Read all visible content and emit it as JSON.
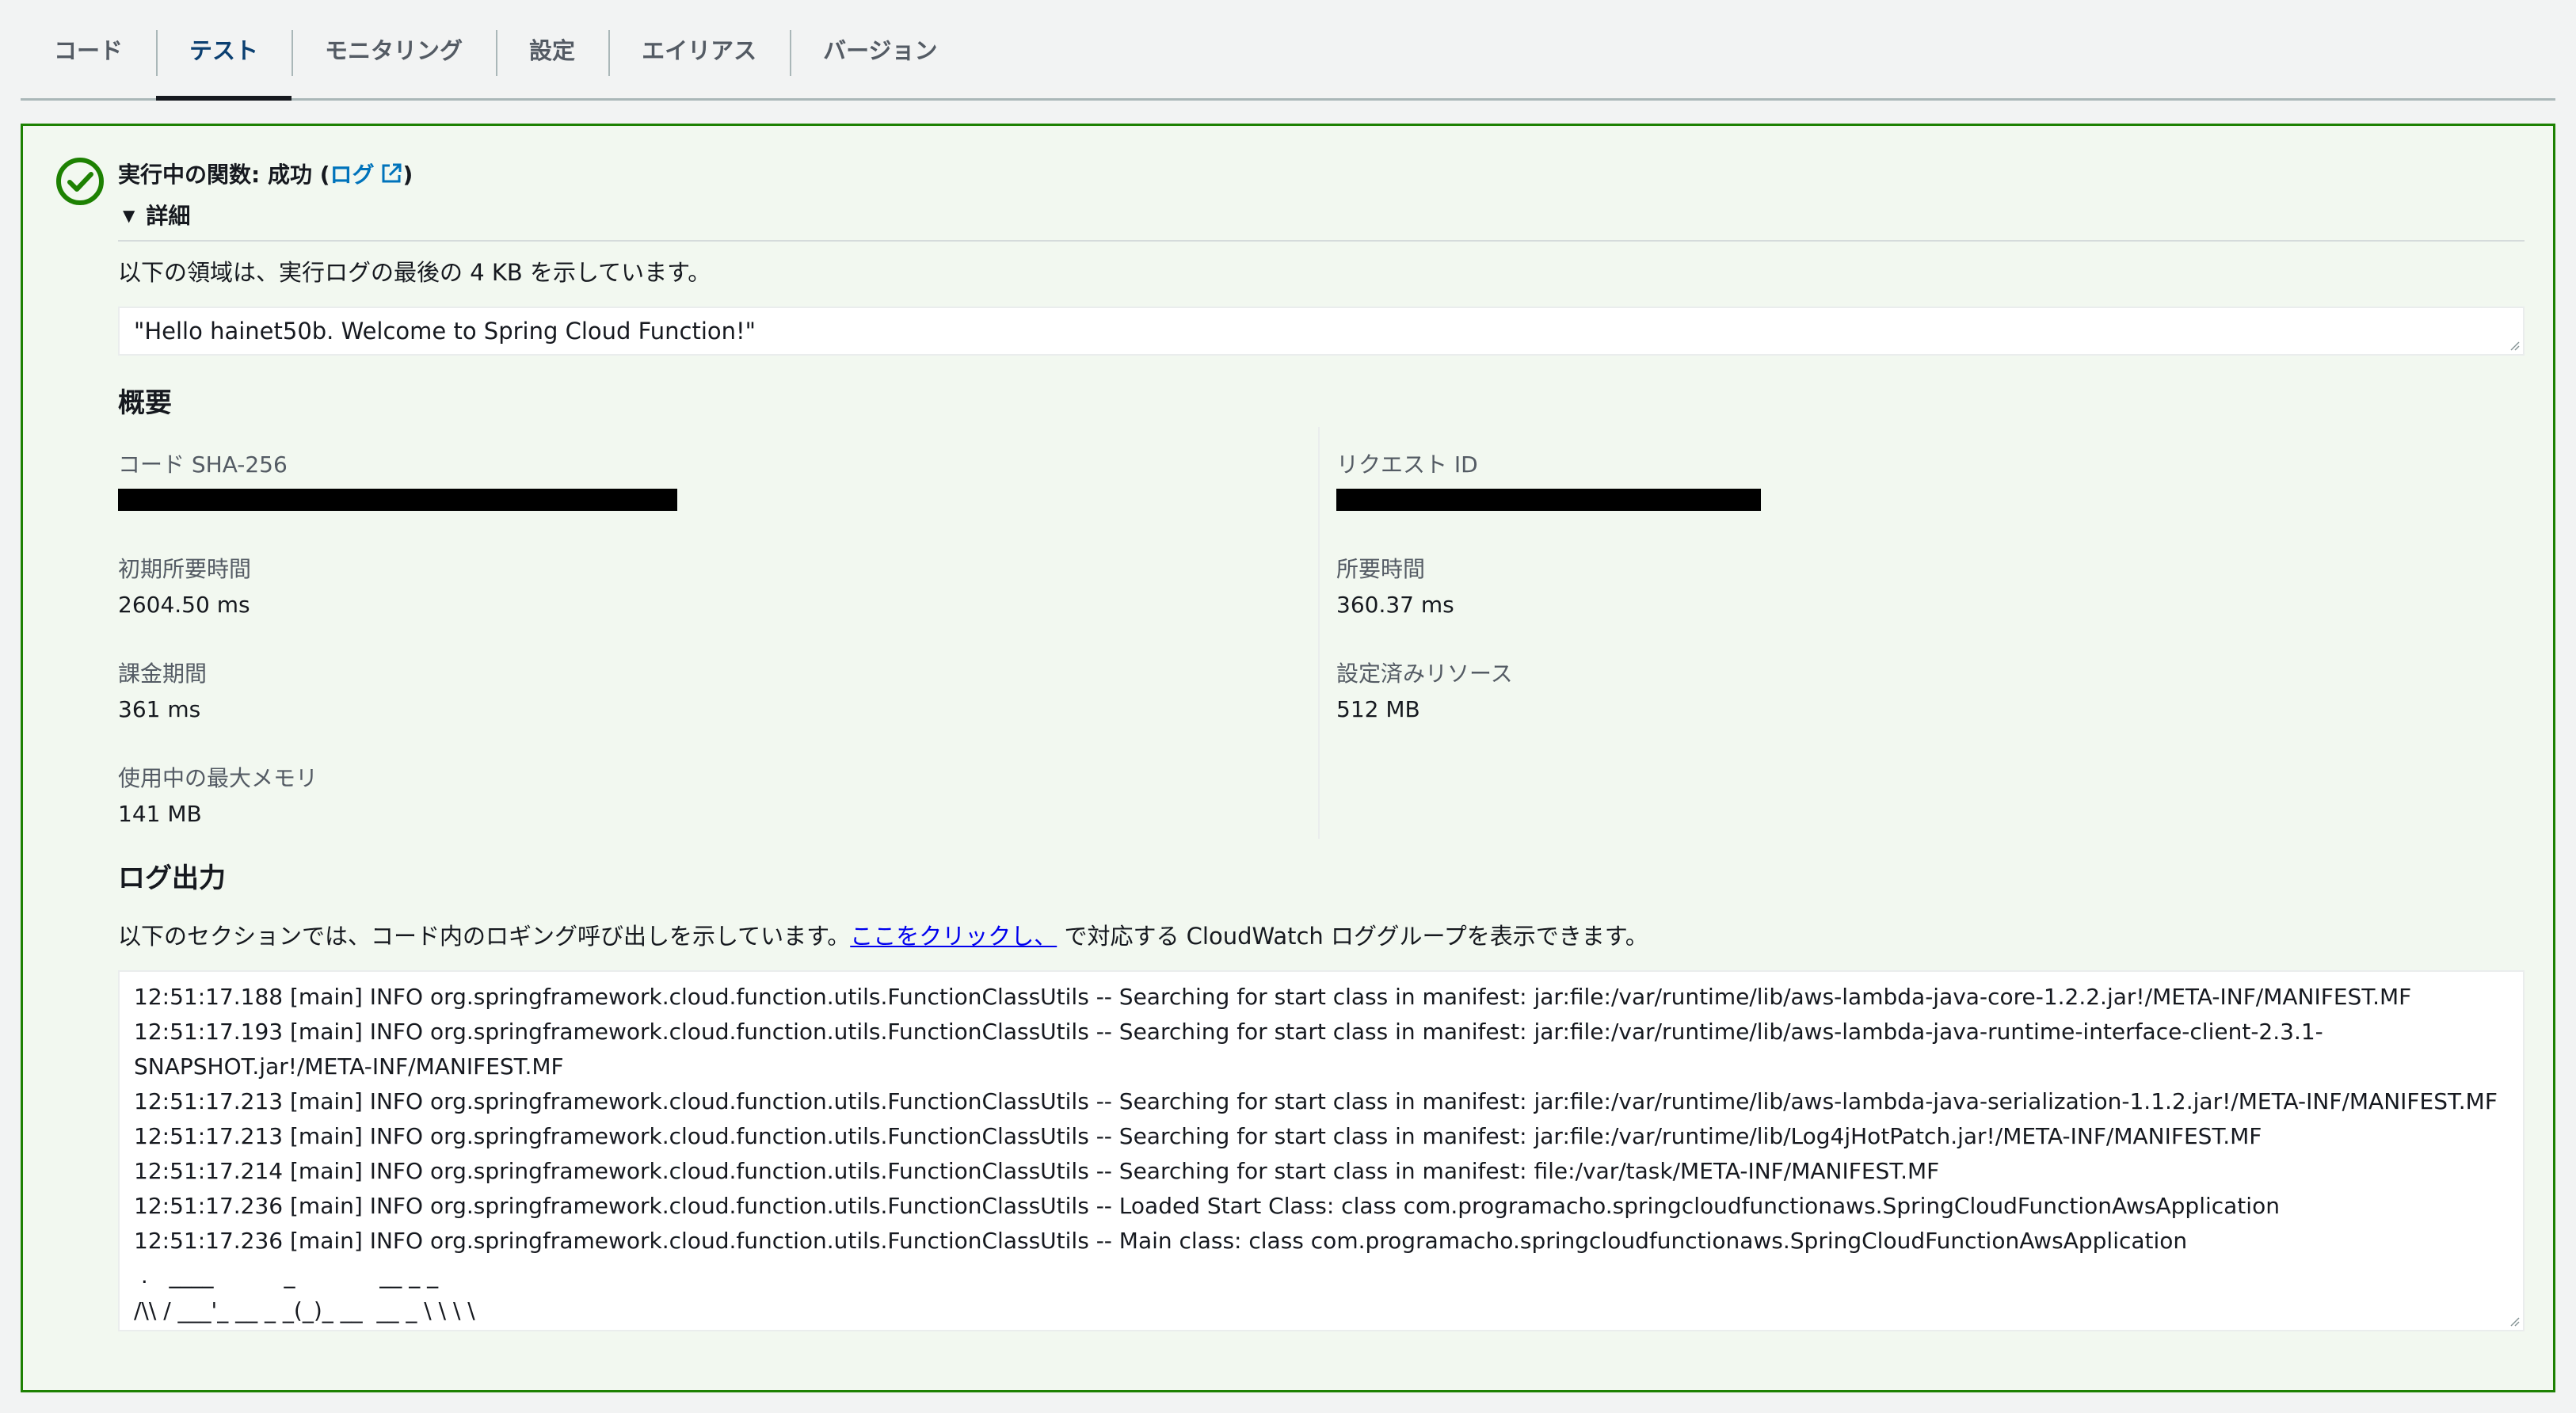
{
  "tabs": [
    {
      "label": "コード"
    },
    {
      "label": "テスト",
      "active": true
    },
    {
      "label": "モニタリング"
    },
    {
      "label": "設定"
    },
    {
      "label": "エイリアス"
    },
    {
      "label": "バージョン"
    }
  ],
  "result": {
    "status_prefix": "実行中の関数: 成功 (",
    "log_link": "ログ",
    "status_suffix": ")",
    "details_label": "詳細",
    "description": "以下の領域は、実行ログの最後の 4 KB を示しています。",
    "output": "\"Hello hainet50b. Welcome to Spring Cloud Function!\""
  },
  "summary": {
    "title": "概要",
    "code_sha_label": "コード SHA-256",
    "request_id_label": "リクエスト ID",
    "init_duration_label": "初期所要時間",
    "init_duration_value": "2604.50 ms",
    "duration_label": "所要時間",
    "duration_value": "360.37 ms",
    "billed_label": "課金期間",
    "billed_value": "361 ms",
    "memory_configured_label": "設定済みリソース",
    "memory_configured_value": "512 MB",
    "max_memory_label": "使用中の最大メモリ",
    "max_memory_value": "141 MB"
  },
  "log_output": {
    "title": "ログ出力",
    "desc_before": "以下のセクションでは、コード内のロギング呼び出しを示しています。",
    "link_text": "ここをクリックし、",
    "desc_after": " で対応する CloudWatch ロググループを表示できます。",
    "lines": [
      "12:51:17.188 [main] INFO org.springframework.cloud.function.utils.FunctionClassUtils -- Searching for start class in manifest: jar:file:/var/runtime/lib/aws-lambda-java-core-1.2.2.jar!/META-INF/MANIFEST.MF",
      "12:51:17.193 [main] INFO org.springframework.cloud.function.utils.FunctionClassUtils -- Searching for start class in manifest: jar:file:/var/runtime/lib/aws-lambda-java-runtime-interface-client-2.3.1-SNAPSHOT.jar!/META-INF/MANIFEST.MF",
      "12:51:17.213 [main] INFO org.springframework.cloud.function.utils.FunctionClassUtils -- Searching for start class in manifest: jar:file:/var/runtime/lib/aws-lambda-java-serialization-1.1.2.jar!/META-INF/MANIFEST.MF",
      "12:51:17.213 [main] INFO org.springframework.cloud.function.utils.FunctionClassUtils -- Searching for start class in manifest: jar:file:/var/runtime/lib/Log4jHotPatch.jar!/META-INF/MANIFEST.MF",
      "12:51:17.214 [main] INFO org.springframework.cloud.function.utils.FunctionClassUtils -- Searching for start class in manifest: file:/var/task/META-INF/MANIFEST.MF",
      "12:51:17.236 [main] INFO org.springframework.cloud.function.utils.FunctionClassUtils -- Loaded Start Class: class com.programacho.springcloudfunctionaws.SpringCloudFunctionAwsApplication",
      "12:51:17.236 [main] INFO org.springframework.cloud.function.utils.FunctionClassUtils -- Main class: class com.programacho.springcloudfunctionaws.SpringCloudFunctionAwsApplication",
      " .   ____          _            __ _ _",
      "/\\\\ / ___'_ __ _ _(_)_ __  __ _ \\ \\ \\ \\"
    ]
  },
  "colors": {
    "success": "#1d8102",
    "link": "#0073bb",
    "active_tab": "#0b3f71"
  },
  "icons": [
    "check-circle-icon",
    "external-link-icon",
    "caret-down-icon",
    "resize-grip-icon"
  ]
}
